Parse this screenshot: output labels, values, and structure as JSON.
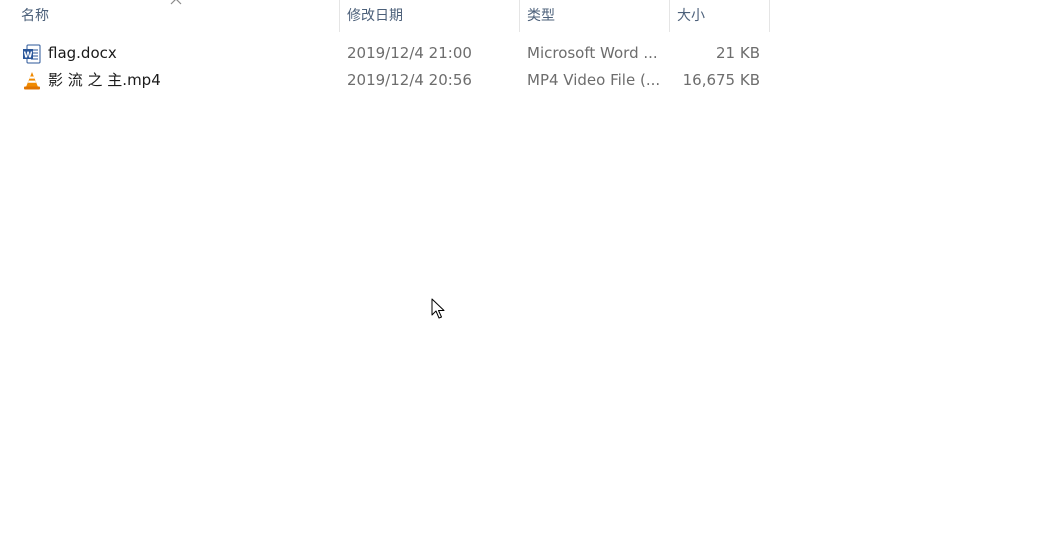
{
  "columns": {
    "name": "名称",
    "date": "修改日期",
    "type": "类型",
    "size": "大小"
  },
  "sort": {
    "column": "name",
    "direction": "ascending",
    "icon": "chevron-up-icon"
  },
  "files": [
    {
      "name": "flag.docx",
      "date": "2019/12/4 21:00",
      "type": "Microsoft Word ...",
      "size": "21 KB",
      "icon": "word-document-icon"
    },
    {
      "name": "影 流 之 主.mp4",
      "date": "2019/12/4 20:56",
      "type": "MP4 Video File (...",
      "size": "16,675 KB",
      "icon": "vlc-cone-icon"
    }
  ],
  "colors": {
    "header_text": "#4c607a",
    "detail_text": "#6d6d6d",
    "word_blue": "#2b579a",
    "vlc_orange": "#f08a00"
  }
}
